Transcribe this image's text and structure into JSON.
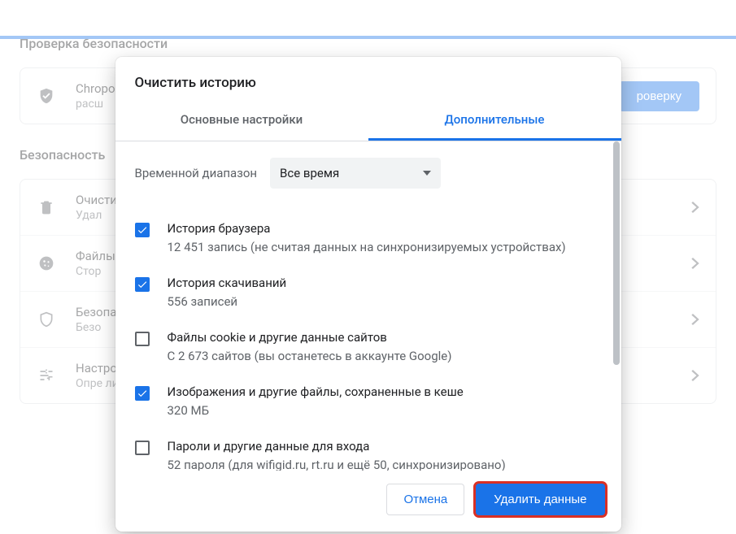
{
  "page": {
    "section1_title": "Проверка безопасности",
    "safety_row": {
      "line1": "Chroроверку проверку безопасности браузера",
      "line2": "расш"
    },
    "check_button": "роверку",
    "section2_title": "Безопасность",
    "rows": [
      {
        "title": "Очистить историю",
        "subtitle": "Удал"
      },
      {
        "title": "Файлы cookie и другие данные сайтов",
        "subtitle": "Стор"
      },
      {
        "title": "Безопасность",
        "subtitle": "Безо"
      },
      {
        "title": "Настройки сайтов",
        "subtitle": "Опре ли у окон",
        "multi": true
      }
    ]
  },
  "dialog": {
    "title": "Очистить историю",
    "tabs": {
      "basic": "Основные настройки",
      "advanced": "Дополнительные"
    },
    "time_label": "Временной диапазон",
    "time_value": "Все время",
    "items": [
      {
        "checked": true,
        "title": "История браузера",
        "subtitle": "12 451 запись (не считая данных на синхронизируемых устройствах)"
      },
      {
        "checked": true,
        "title": "История скачиваний",
        "subtitle": "556 записей"
      },
      {
        "checked": false,
        "title": "Файлы cookie и другие данные сайтов",
        "subtitle": "С 2 673 сайтов (вы останетесь в аккаунте Google)"
      },
      {
        "checked": true,
        "title": "Изображения и другие файлы, сохраненные в кеше",
        "subtitle": "320 МБ"
      },
      {
        "checked": false,
        "title": "Пароли и другие данные для входа",
        "subtitle": "52 пароля (для wifigid.ru, rt.ru и ещё 50, синхронизировано)"
      }
    ],
    "cancel": "Отмена",
    "confirm": "Удалить данные"
  }
}
